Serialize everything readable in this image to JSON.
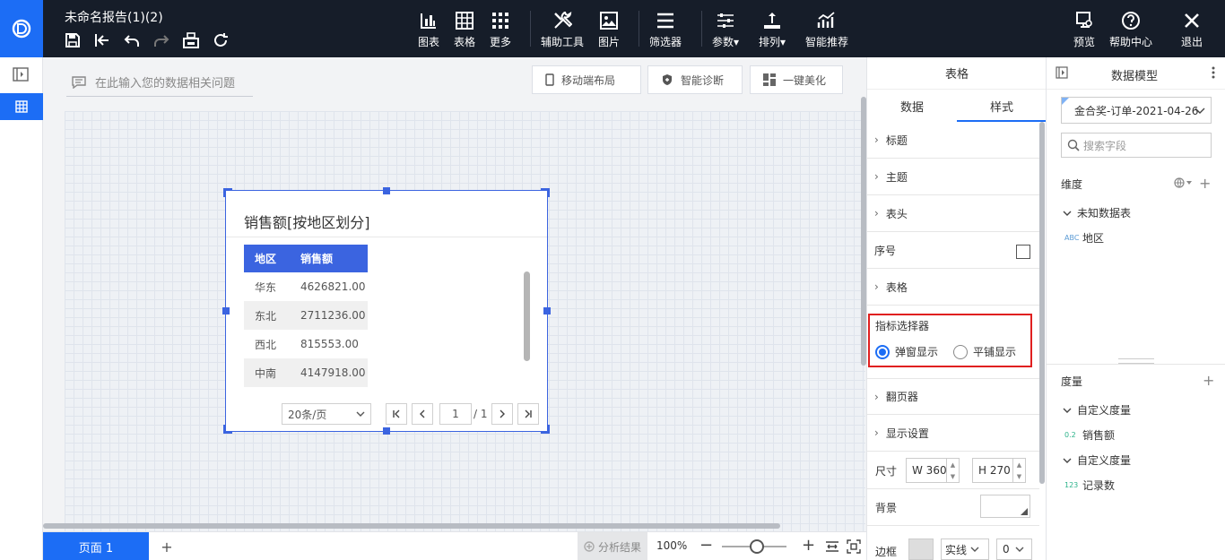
{
  "app": {
    "report_title": "未命名报告(1)(2)",
    "logo_icon": "app-logo-icon"
  },
  "toolbar": {
    "quick_icons": [
      "save-icon",
      "exit-edit-icon",
      "undo-icon",
      "redo-icon",
      "print-icon",
      "refresh-icon"
    ],
    "chart": "图表",
    "table": "表格",
    "more": "更多",
    "tools": "辅助工具",
    "image": "图片",
    "filter": "筛选器",
    "params": "参数",
    "arrange": "排列",
    "smart": "智能推荐",
    "preview": "预览",
    "help": "帮助中心",
    "exit": "退出"
  },
  "workspace": {
    "ask_placeholder": "在此输入您的数据相关问题",
    "mobile_layout": "移动端布局",
    "diagnose": "智能诊断",
    "beautify": "一键美化"
  },
  "widget": {
    "title": "销售额[按地区划分]",
    "headers": [
      "地区",
      "销售额"
    ],
    "rows": [
      {
        "region": "华东",
        "sales": "4626821.00"
      },
      {
        "region": "东北",
        "sales": "2711236.00"
      },
      {
        "region": "西北",
        "sales": "815553.00"
      },
      {
        "region": "中南",
        "sales": "4147918.00"
      }
    ],
    "page_size": "20条/页",
    "page": "1",
    "page_total": "/ 1"
  },
  "bottom": {
    "page_tab": "页面 1",
    "add": "+",
    "analysis": "分析结果",
    "zoom": "100%",
    "zoom_level": 0.45
  },
  "style_panel": {
    "title": "表格",
    "tab_data": "数据",
    "tab_style": "样式",
    "sections": {
      "title": "标题",
      "theme": "主题",
      "header": "表头",
      "serial": "序号",
      "table": "表格",
      "pager": "翻页器",
      "display": "显示设置"
    },
    "serial_checked": false,
    "metric_picker": {
      "label": "指标选择器",
      "opt_popup": "弹窗显示",
      "opt_tile": "平铺显示",
      "selected": "弹窗显示"
    },
    "size_label": "尺寸",
    "width": "W 360",
    "height": "H 270",
    "bg_label": "背景",
    "border_label": "边框",
    "border_style": "实线",
    "border_width": "0"
  },
  "data_model": {
    "title": "数据模型",
    "dataset": "金合奖-订单-2021-04-26",
    "search_placeholder": "搜索字段",
    "dimension": "维度",
    "unknown_table": "未知数据表",
    "field_region": "地区",
    "region_tag": "ABC",
    "measure": "度量",
    "custom_measure": "自定义度量",
    "field_sales": "销售额",
    "sales_tag": "0.2",
    "field_count": "记录数",
    "count_tag": "123"
  },
  "colors": {
    "accent": "#1c6df5",
    "topbar": "#161d29",
    "table_header": "#3b64e0",
    "highlight_box": "#e02020"
  }
}
